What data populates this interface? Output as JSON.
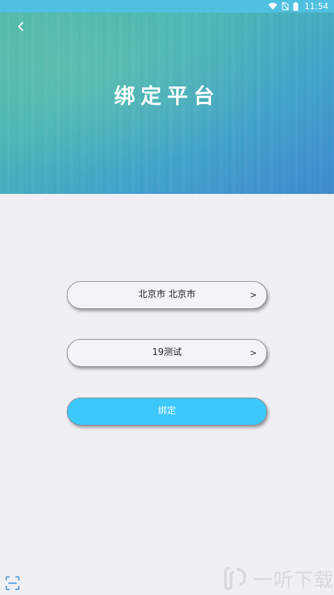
{
  "status_bar": {
    "time": "11:54",
    "icons": [
      "wifi-icon",
      "no-sim-icon",
      "battery-icon"
    ],
    "color": "#4fc0e0"
  },
  "header": {
    "title": "绑定平台",
    "back_icon": "chevron-left-icon",
    "colors": [
      "#4bb6a8",
      "#3a88cc"
    ]
  },
  "form": {
    "region_select": {
      "value": "北京市 北京市",
      "arrow": ">"
    },
    "platform_select": {
      "value": "19测试",
      "arrow": ">"
    },
    "bind_button": {
      "label": "绑定",
      "color": "#3cc8fa"
    }
  },
  "footer": {
    "scan_icon": "scan-icon",
    "watermark": "一听下载"
  }
}
